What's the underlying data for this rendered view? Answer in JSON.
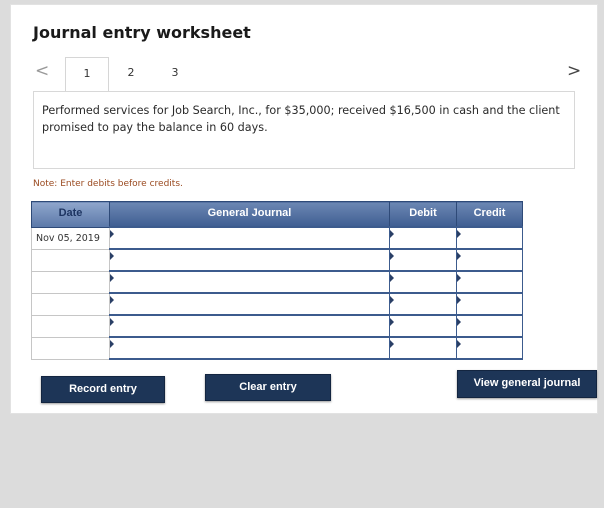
{
  "worksheet": {
    "title": "Journal entry worksheet",
    "nav_prev": "<",
    "nav_next": ">",
    "tabs": [
      {
        "label": "1",
        "active": true
      },
      {
        "label": "2",
        "active": false
      },
      {
        "label": "3",
        "active": false
      }
    ],
    "description": "Performed services for Job Search, Inc., for $35,000; received $16,500 in cash and the client promised to pay the balance in 60 days.",
    "note": "Note: Enter debits before credits."
  },
  "journal": {
    "columns": {
      "date": "Date",
      "general_journal": "General Journal",
      "debit": "Debit",
      "credit": "Credit"
    },
    "rows": [
      {
        "date": "Nov 05, 2019",
        "account": "",
        "debit": "",
        "credit": ""
      },
      {
        "date": "",
        "account": "",
        "debit": "",
        "credit": ""
      },
      {
        "date": "",
        "account": "",
        "debit": "",
        "credit": ""
      },
      {
        "date": "",
        "account": "",
        "debit": "",
        "credit": ""
      },
      {
        "date": "",
        "account": "",
        "debit": "",
        "credit": ""
      },
      {
        "date": "",
        "account": "",
        "debit": "",
        "credit": ""
      }
    ]
  },
  "buttons": {
    "record": "Record entry",
    "clear": "Clear entry",
    "view": "View general journal"
  },
  "colors": {
    "header_blue": "#3f5e92",
    "button_navy": "#1d3557",
    "note_text": "#9a4a20"
  }
}
